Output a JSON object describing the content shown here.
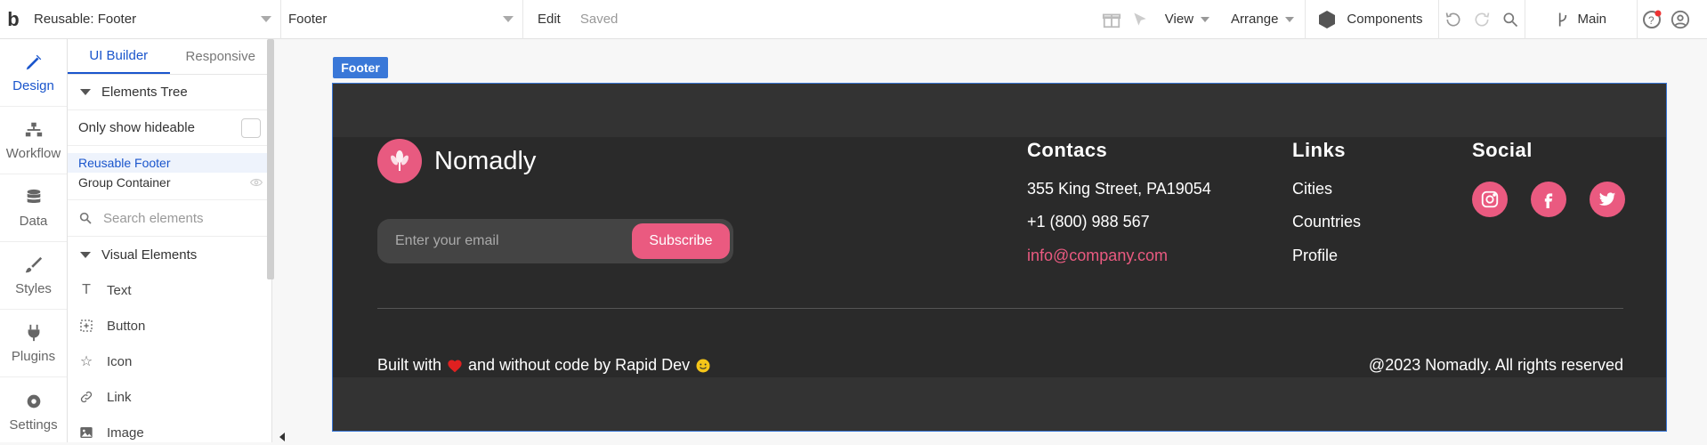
{
  "topbar": {
    "logo": "b",
    "page_select": "Reusable: Footer",
    "element_select": "Footer",
    "edit": "Edit",
    "status": "Saved",
    "view": "View",
    "arrange": "Arrange",
    "components": "Components",
    "branch": "Main"
  },
  "rail": {
    "items": [
      {
        "label": "Design",
        "icon": "brush-icon"
      },
      {
        "label": "Workflow",
        "icon": "workflow-icon"
      },
      {
        "label": "Data",
        "icon": "database-icon"
      },
      {
        "label": "Styles",
        "icon": "paintbrush-icon"
      },
      {
        "label": "Plugins",
        "icon": "plug-icon"
      },
      {
        "label": "Settings",
        "icon": "gear-icon"
      }
    ]
  },
  "panel": {
    "tabs": [
      "UI Builder",
      "Responsive"
    ],
    "elements_tree": "Elements Tree",
    "only_show_hideable": "Only show hideable",
    "tree": [
      "Reusable Footer",
      "Group Container"
    ],
    "search_placeholder": "Search elements",
    "visual_elements": "Visual Elements",
    "elements": [
      {
        "label": "Text",
        "icon": "text-icon"
      },
      {
        "label": "Button",
        "icon": "button-icon"
      },
      {
        "label": "Icon",
        "icon": "star-icon"
      },
      {
        "label": "Link",
        "icon": "link-icon"
      },
      {
        "label": "Image",
        "icon": "image-icon"
      }
    ]
  },
  "canvas": {
    "element_label": "Footer",
    "brand": "Nomadly",
    "email_placeholder": "Enter your email",
    "subscribe": "Subscribe",
    "contacts": {
      "heading": "Contacs",
      "address": "355 King Street, PA19054",
      "phone": "+1 (800) 988 567",
      "email": "info@company.com"
    },
    "links": {
      "heading": "Links",
      "items": [
        "Cities",
        "Countries",
        "Profile"
      ]
    },
    "social": {
      "heading": "Social",
      "icons": [
        "instagram-icon",
        "facebook-icon",
        "twitter-icon"
      ]
    },
    "built_prefix": "Built with",
    "built_suffix": "and without code by Rapid Dev",
    "rights": "@2023 Nomadly. All rights reserved"
  },
  "colors": {
    "accent": "#1a55cc",
    "footer_bg": "#333333",
    "pink": "#ea5a80"
  }
}
